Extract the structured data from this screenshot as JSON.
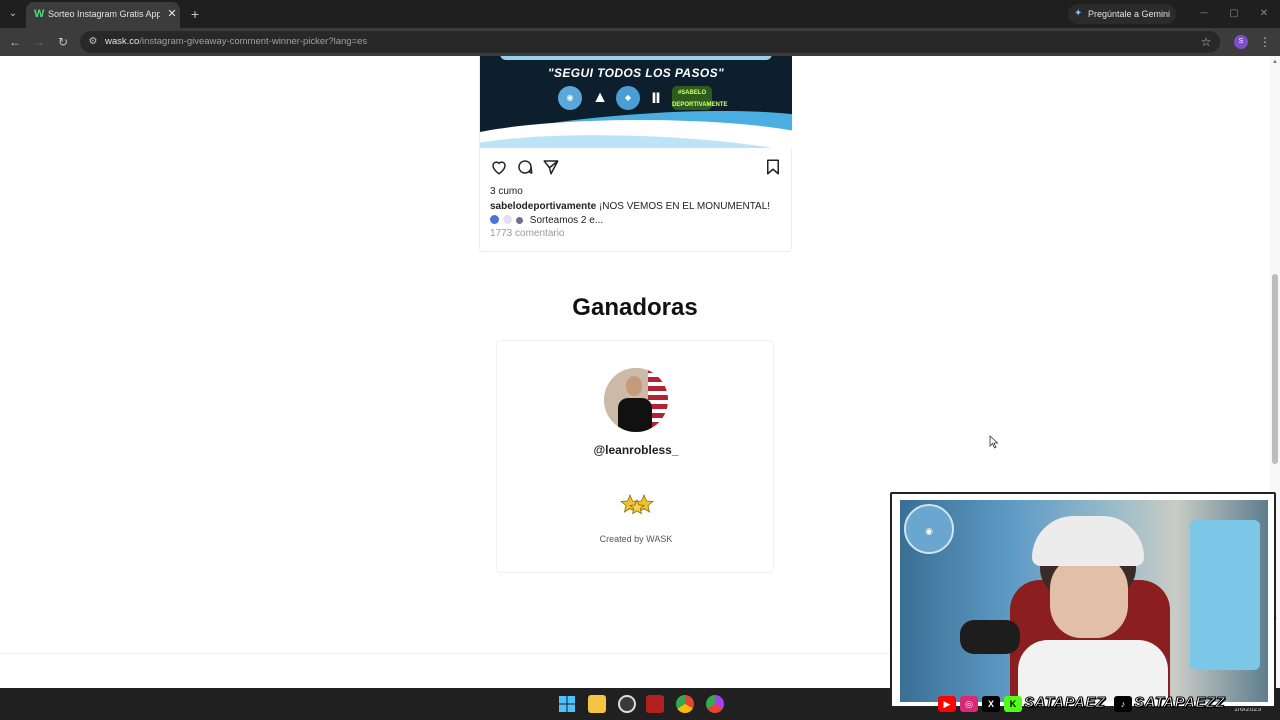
{
  "browser": {
    "tab_title": "Sorteo Instagram Gratis App - S",
    "gemini_label": "Pregúntale a Gemini",
    "url_main": "wask.co",
    "url_path": "/instagram-giveaway-comment-winner-picker?lang=es",
    "profile_initial": "S"
  },
  "post": {
    "banner_text": "\"SEGUI TODOS LOS PASOS\"",
    "logos": [
      "ALPHA",
      "AC",
      "#SABELO DEPORTIVAMENTE"
    ],
    "likes": "3 cumo",
    "username": "sabelodeportivamente",
    "caption_line1": "¡NOS VEMOS EN EL MONUMENTAL!",
    "caption_line2": "Sorteamos 2 e...",
    "comments": "1773 comentario"
  },
  "winners": {
    "title": "Ganadoras",
    "handle": "@leanrobless_",
    "created_by": "Created by WASK"
  },
  "stream_overlay": {
    "handle1": "SATAPAEZ",
    "handle2": "SATAPAEZZ"
  },
  "taskbar": {
    "date": "1/6/2025"
  },
  "colors": {
    "chrome_dark": "#1f1f1f",
    "chrome_bar": "#3c3c3c",
    "accent_green": "#4ade80",
    "banner_blue": "#4aaee0"
  }
}
